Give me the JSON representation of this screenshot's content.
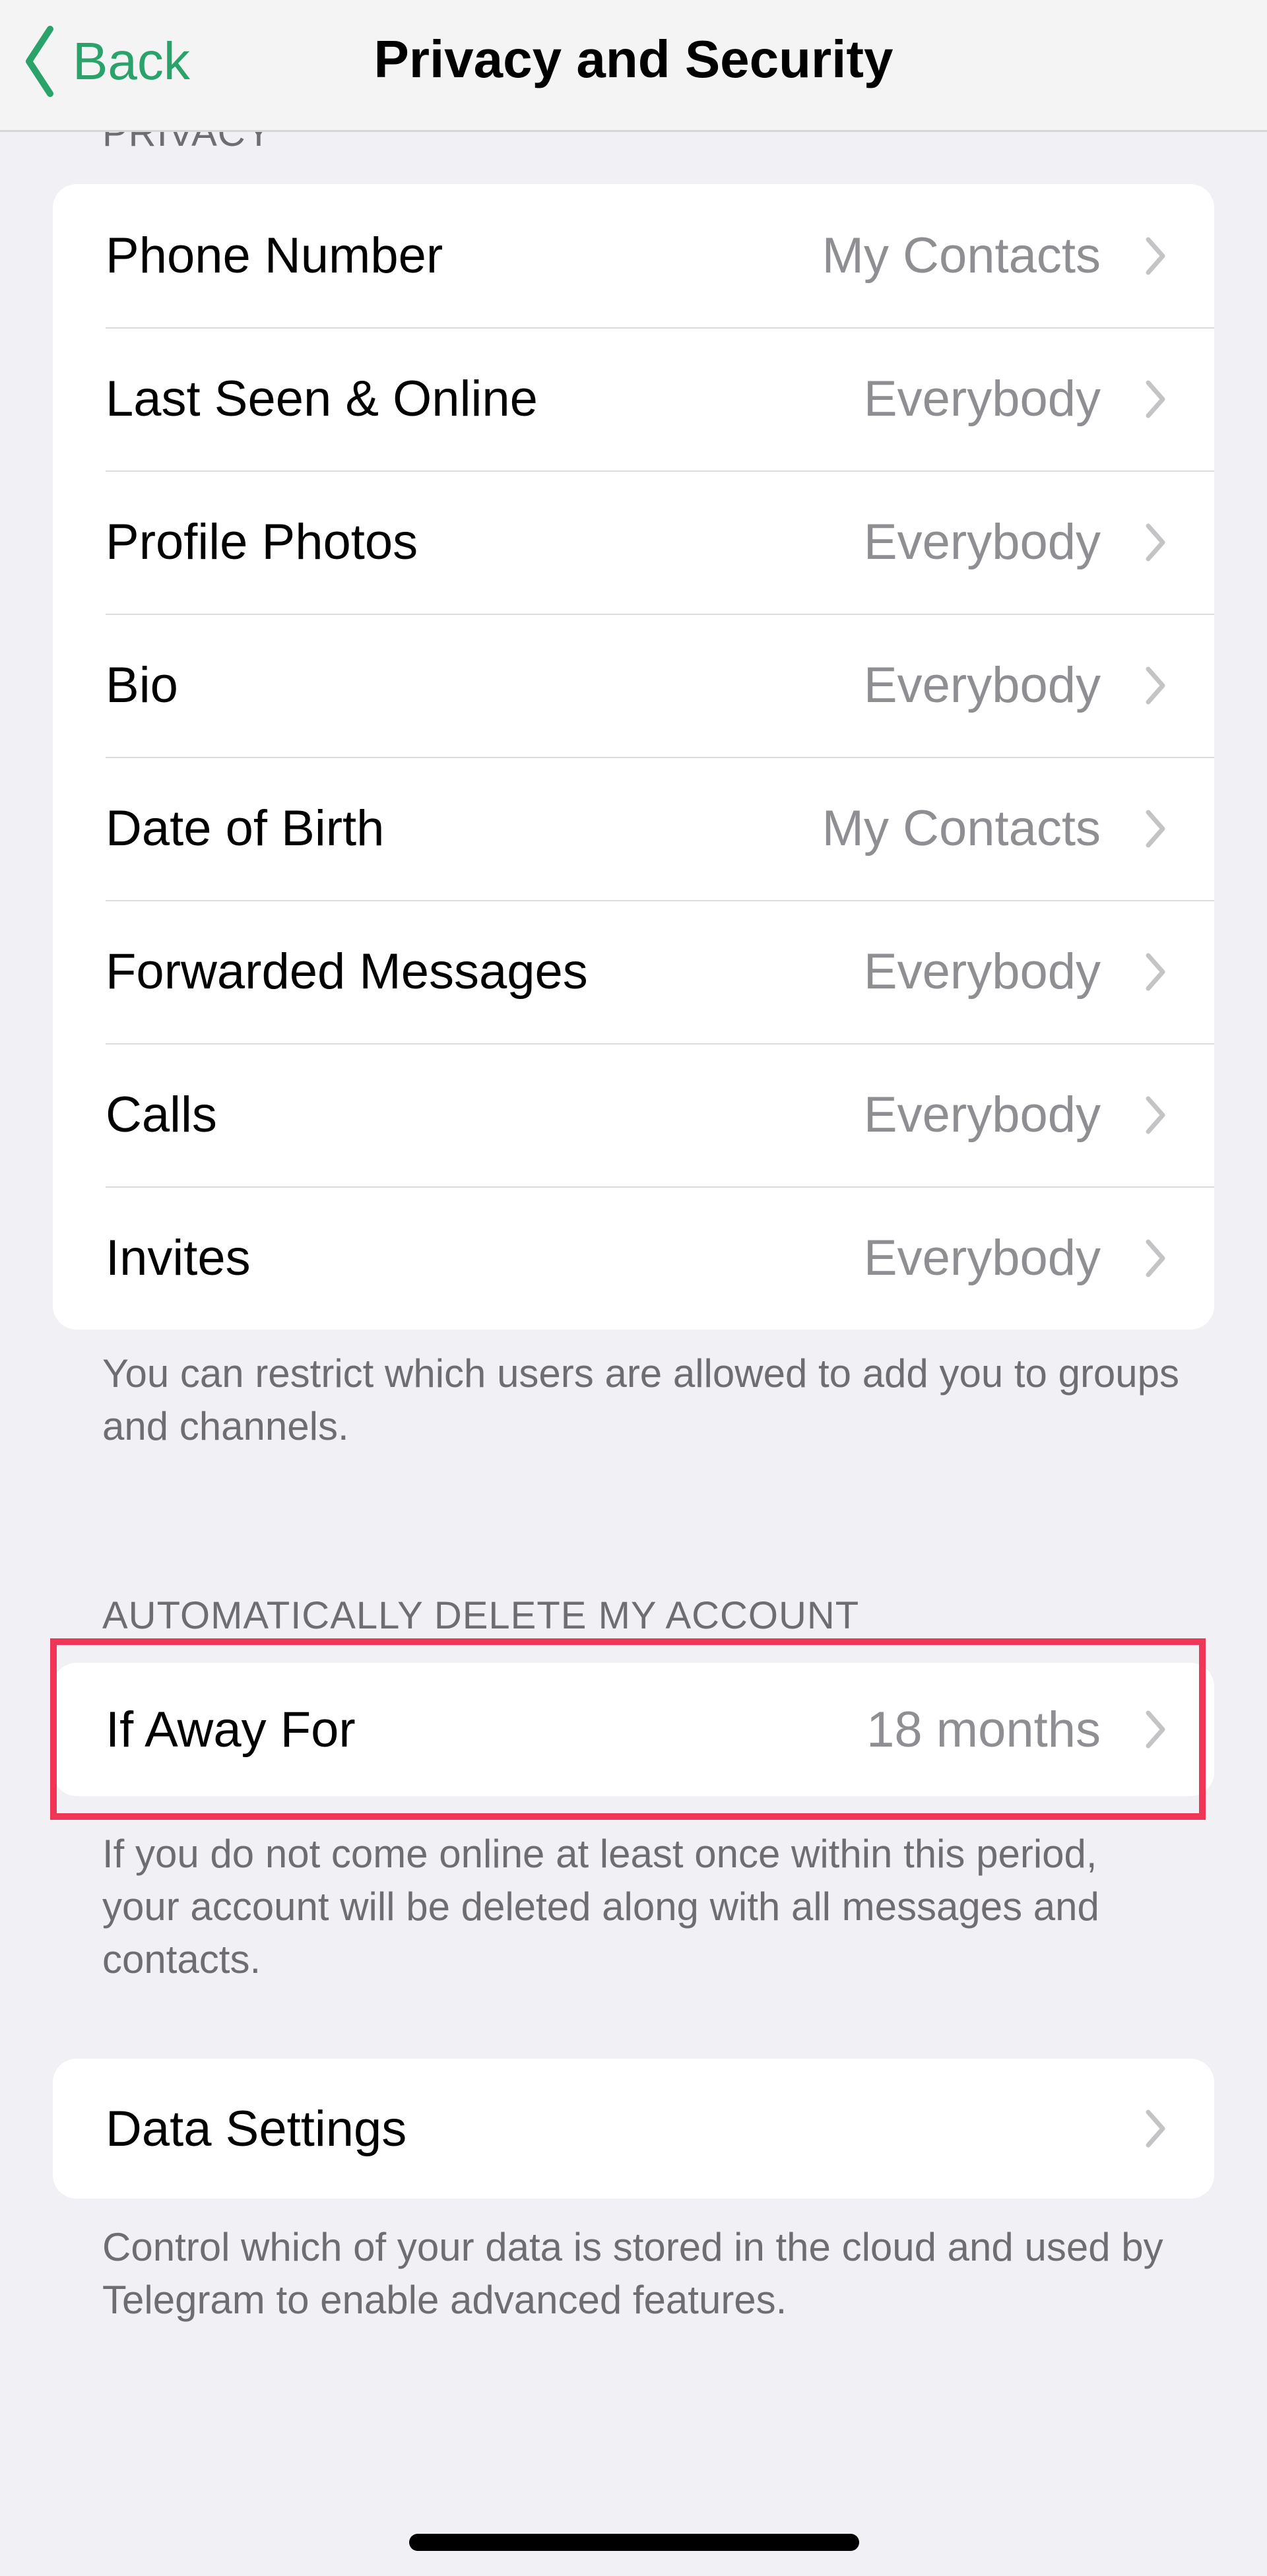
{
  "header": {
    "back_label": "Back",
    "title": "Privacy and Security"
  },
  "colors": {
    "accent": "#2aa36a",
    "highlight": "#ef3656"
  },
  "privacy": {
    "heading": "PRIVACY",
    "items": [
      {
        "label": "Phone Number",
        "value": "My Contacts"
      },
      {
        "label": "Last Seen & Online",
        "value": "Everybody"
      },
      {
        "label": "Profile Photos",
        "value": "Everybody"
      },
      {
        "label": "Bio",
        "value": "Everybody"
      },
      {
        "label": "Date of Birth",
        "value": "My Contacts"
      },
      {
        "label": "Forwarded Messages",
        "value": "Everybody"
      },
      {
        "label": "Calls",
        "value": "Everybody"
      },
      {
        "label": "Invites",
        "value": "Everybody"
      }
    ],
    "footer": "You can restrict which users are allowed to add you to groups and channels."
  },
  "auto_delete": {
    "heading": "AUTOMATICALLY DELETE MY ACCOUNT",
    "item": {
      "label": "If Away For",
      "value": "18 months"
    },
    "footer": "If you do not come online at least once within this period, your account will be deleted along with all messages and contacts."
  },
  "data_settings": {
    "item": {
      "label": "Data Settings"
    },
    "footer": "Control which of your data is stored in the cloud and used by Telegram to enable advanced features."
  }
}
